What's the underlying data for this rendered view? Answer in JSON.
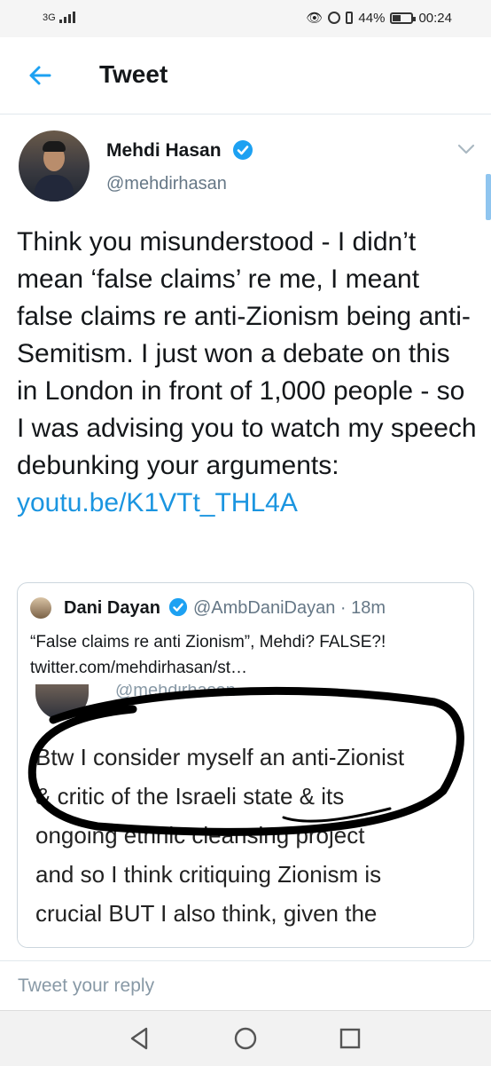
{
  "status_bar": {
    "network": "3G",
    "battery": "44%",
    "time": "00:24",
    "icons": [
      "eye-icon",
      "alarm-icon",
      "vibrate-icon",
      "battery-icon"
    ],
    "battery_level": 0.44
  },
  "header": {
    "title": "Tweet",
    "back_icon": "arrow-left-icon"
  },
  "tweet": {
    "author_name": "Mehdi Hasan",
    "author_handle": "@mehdirhasan",
    "text": "Think you misunderstood - I didn’t mean ‘false claims’ re me, I meant false claims re anti-Zionism being anti-Semitism. I just won a debate on this in London in front of 1,000 people - so I was advising you to watch my speech debunking your arguments:",
    "link": "youtu.be/K1VTt_THL4A"
  },
  "quoted_tweet": {
    "author_name": "Dani Dayan",
    "author_handle": "@AmbDaniDayan · 18m",
    "text_line1": "“False claims re anti Zionism”, Mehdi? FALSE?!",
    "text_line2": "twitter.com/mehdirhasan/st…",
    "image": {
      "handle": "@mehdirhasan",
      "line1": "Btw I consider myself an anti-Zionist",
      "line2": "& critic of the Israeli state & its",
      "line3": "ongoing ethnic cleansing project",
      "line4": "and so I think critiquing Zionism is",
      "line5": "crucial BUT I also think, given the"
    }
  },
  "reply": {
    "placeholder": "Tweet your reply"
  },
  "colors": {
    "accent": "#1da1f2",
    "link": "#1b95e0",
    "text": "#14171a",
    "secondary": "#657786"
  }
}
